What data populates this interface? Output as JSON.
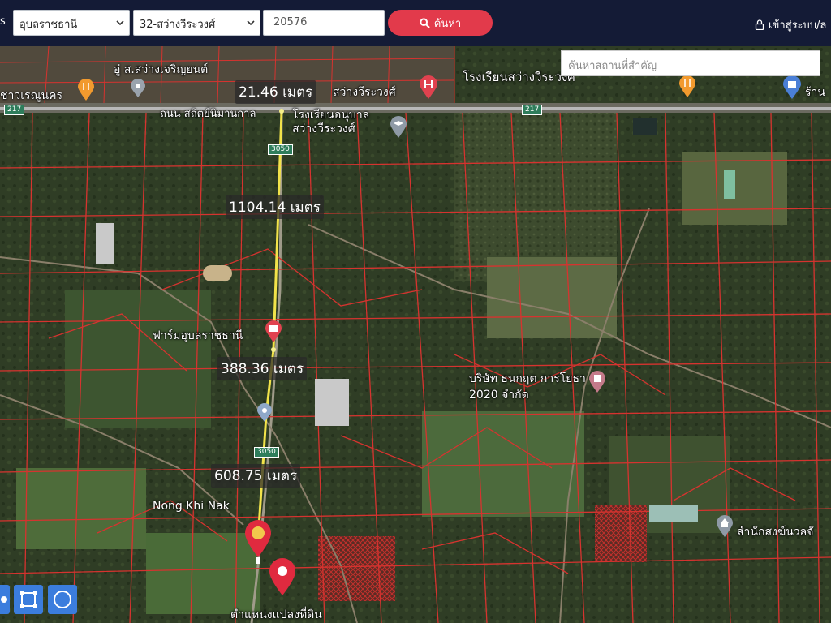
{
  "topbar": {
    "cut_label": "s",
    "province": "อุบลราชธานี",
    "district": "32-สว่างวีระวงศ์",
    "parcel_number": "20576",
    "search_label": "ค้นหา",
    "login_label": "เข้าสู่ระบบ/ล"
  },
  "map": {
    "place_search_placeholder": "ค้นหาสถานที่สำคัญ",
    "place_labels": {
      "road": "ถนน สถิตย์นิมานกาล",
      "school_sawang": "โรงเรียนสว่างวีระวงศ์",
      "kindergarten": "โรงเรียนอนุบาลสว่างวีระวงศ์",
      "garage": "อู่ ส.สว่างเจริญยนต์",
      "hospital": "สว่างวีระวงศ์",
      "left_poi": "ชาวเรณูนคร",
      "farm": "ฟาร์มอุบลราชธานี",
      "company": "บริษัท ธนกฤต การโยธา 2020 จำกัด",
      "village": "Nong Khi Nak",
      "monastery": "สำนักสงฆ์นวลจั",
      "shop": "ร้าน",
      "parcel_location": "ตำแหน่งแปลงที่ดิน"
    },
    "route_shields": [
      "217",
      "217",
      "3050",
      "3050"
    ],
    "measurements": [
      "21.46 เมตร",
      "1104.14 เมตร",
      "388.36 เมตร",
      "608.75 เมตร"
    ],
    "colors": {
      "parcel_border": "#d6332f",
      "measure_line": "#f2e34a",
      "marker": "#e02a3f",
      "tool_button": "#3b7ddd",
      "topbar": "#141b36",
      "search_button": "#e23a4b"
    },
    "tools": [
      "hand-icon",
      "rectangle-draw-icon",
      "circle-draw-icon"
    ]
  }
}
